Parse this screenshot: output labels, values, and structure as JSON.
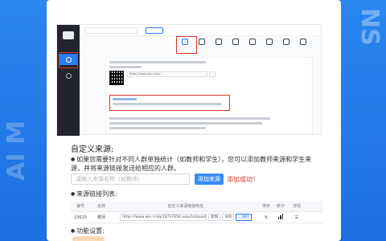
{
  "watermarks": {
    "right": "NS",
    "left": "AI M"
  },
  "colors": {
    "accent": "#2e7ef0",
    "highlight": "#d8392b",
    "background": "#1f7ce8"
  },
  "screenshot": {
    "nav": {
      "items": [
        {
          "icon": "send-icon",
          "label": ""
        },
        {
          "icon": "grid-icon",
          "label": ""
        }
      ]
    },
    "search": {
      "value": ""
    },
    "top_button": "",
    "toolbar": [
      {
        "icon": "qr-code-icon",
        "active": true
      },
      {
        "icon": "chart-icon"
      },
      {
        "icon": "grid-icon"
      },
      {
        "icon": "doc-icon"
      },
      {
        "icon": "link-icon"
      },
      {
        "icon": "gear-icon"
      },
      {
        "icon": "image-icon"
      },
      {
        "icon": "clock-icon"
      }
    ],
    "url": "https://www.wjx.cn/vj/..."
  },
  "section": {
    "title": "自定义来源:",
    "description": "如果您需要针对不同人群单独统计（如教师和学生），您可以添加教师来源和学生来源，并将来源链接发送给相应的人群。",
    "input_placeholder": "请输入来源名称（如教师）",
    "add_button": "添加来源",
    "add_note": "添加成功！",
    "list_title": "来源链接列表:",
    "table": {
      "headers": [
        "编号",
        "名称",
        "自定义来源链接地址",
        "排序",
        "统计",
        "详情"
      ],
      "rows": [
        {
          "id": "10629",
          "name": "教师",
          "url": "https://www.wjx.cn/jq/18737656.aspx?sdsouid=10",
          "copy": "复制",
          "qr": "访问",
          "button": "二维码"
        }
      ]
    },
    "func_title": "功能设置:"
  }
}
